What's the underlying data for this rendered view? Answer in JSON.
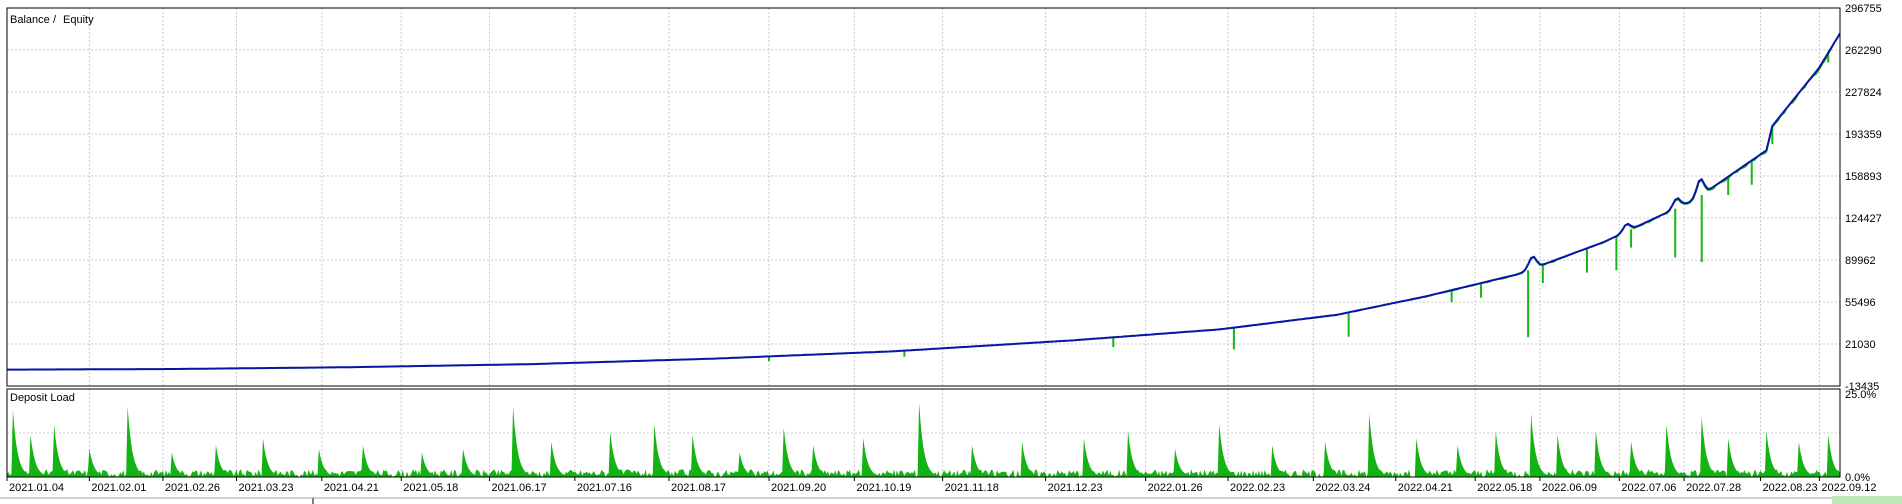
{
  "colors": {
    "balance": "#0a14a6",
    "equity": "#14b814",
    "deposit_load": "#13b313",
    "grid": "#c8c8c8",
    "frame": "#000000",
    "background": "#ffffff"
  },
  "chart_data": [
    {
      "type": "line",
      "panel": "balance-equity",
      "legend": {
        "placement": "top-left",
        "separator": "/"
      },
      "series": [
        {
          "name": "Balance",
          "color": "#0a14a6"
        },
        {
          "name": "Equity",
          "color": "#14b814"
        }
      ],
      "y_ticks": [
        "296755",
        "262290",
        "227824",
        "193359",
        "158893",
        "124427",
        "89962",
        "55496",
        "21030",
        "-13435"
      ],
      "ylim": [
        -13435,
        296755
      ],
      "grid": true,
      "x_start": "2021.01.04",
      "x_end": "2022.09.19",
      "balance_points": [
        [
          "2021.01.04",
          0
        ],
        [
          "2021.03.01",
          500
        ],
        [
          "2021.05.01",
          2000
        ],
        [
          "2021.07.01",
          4500
        ],
        [
          "2021.09.01",
          9000
        ],
        [
          "2021.11.01",
          15000
        ],
        [
          "2022.01.01",
          24000
        ],
        [
          "2022.02.20",
          33000
        ],
        [
          "2022.04.01",
          45000
        ],
        [
          "2022.05.01",
          60000
        ],
        [
          "2022.06.01",
          78000
        ],
        [
          "2022.07.01",
          105000
        ],
        [
          "2022.08.01",
          140000
        ],
        [
          "2022.08.25",
          180000
        ],
        [
          "2022.08.27",
          200000
        ],
        [
          "2022.09.12",
          248000
        ],
        [
          "2022.09.19",
          276000
        ]
      ],
      "balance_bumps": [
        [
          "2022.06.06",
          10000
        ],
        [
          "2022.07.08",
          6000
        ],
        [
          "2022.07.25",
          8000
        ],
        [
          "2022.08.02",
          14000
        ]
      ],
      "equity_drops": [
        [
          "2021.09.20",
          4000
        ],
        [
          "2021.11.05",
          5000
        ],
        [
          "2022.01.15",
          8000
        ],
        [
          "2022.02.25",
          18000
        ],
        [
          "2022.04.05",
          20000
        ],
        [
          "2022.05.10",
          10000
        ],
        [
          "2022.05.20",
          12000
        ],
        [
          "2022.06.05",
          55000
        ],
        [
          "2022.06.10",
          15000
        ],
        [
          "2022.06.25",
          20000
        ],
        [
          "2022.07.05",
          28000
        ],
        [
          "2022.07.10",
          15000
        ],
        [
          "2022.07.25",
          40000
        ],
        [
          "2022.08.03",
          55000
        ],
        [
          "2022.08.12",
          15000
        ],
        [
          "2022.08.20",
          20000
        ],
        [
          "2022.08.27",
          15000
        ],
        [
          "2022.09.15",
          8000
        ]
      ]
    },
    {
      "type": "area",
      "panel": "deposit-load",
      "title": "Deposit Load",
      "y_ticks": [
        "25.0%",
        "0.0%"
      ],
      "ylim": [
        0,
        25
      ],
      "grid": true,
      "peaks": [
        [
          "2021.01.06",
          19
        ],
        [
          "2021.01.12",
          12
        ],
        [
          "2021.01.20",
          15
        ],
        [
          "2021.02.01",
          8
        ],
        [
          "2021.02.14",
          20
        ],
        [
          "2021.03.01",
          7
        ],
        [
          "2021.03.16",
          9
        ],
        [
          "2021.04.01",
          11
        ],
        [
          "2021.04.20",
          8
        ],
        [
          "2021.05.05",
          9
        ],
        [
          "2021.05.25",
          7
        ],
        [
          "2021.06.08",
          8
        ],
        [
          "2021.06.25",
          20
        ],
        [
          "2021.07.08",
          10
        ],
        [
          "2021.07.28",
          13
        ],
        [
          "2021.08.12",
          15
        ],
        [
          "2021.08.25",
          12
        ],
        [
          "2021.09.10",
          7
        ],
        [
          "2021.09.25",
          14
        ],
        [
          "2021.10.05",
          9
        ],
        [
          "2021.10.22",
          11
        ],
        [
          "2021.11.10",
          21
        ],
        [
          "2021.11.28",
          9
        ],
        [
          "2021.12.15",
          10
        ],
        [
          "2022.01.05",
          11
        ],
        [
          "2022.01.20",
          13
        ],
        [
          "2022.02.05",
          8
        ],
        [
          "2022.02.20",
          15
        ],
        [
          "2022.03.10",
          9
        ],
        [
          "2022.03.28",
          10
        ],
        [
          "2022.04.12",
          18
        ],
        [
          "2022.04.28",
          11
        ],
        [
          "2022.05.12",
          9
        ],
        [
          "2022.05.25",
          13
        ],
        [
          "2022.06.06",
          18
        ],
        [
          "2022.06.15",
          12
        ],
        [
          "2022.06.28",
          13
        ],
        [
          "2022.07.10",
          10
        ],
        [
          "2022.07.22",
          15
        ],
        [
          "2022.08.03",
          17
        ],
        [
          "2022.08.12",
          11
        ],
        [
          "2022.08.25",
          13
        ],
        [
          "2022.09.05",
          10
        ],
        [
          "2022.09.15",
          12
        ]
      ]
    }
  ],
  "x_axis": {
    "labels": [
      "2021.01.04",
      "2021.02.01",
      "2021.02.26",
      "2021.03.23",
      "2021.04.21",
      "2021.05.18",
      "2021.06.17",
      "2021.07.16",
      "2021.08.17",
      "2021.09.20",
      "2021.10.19",
      "2021.11.18",
      "2021.12.23",
      "2022.01.26",
      "2022.02.23",
      "2022.03.24",
      "2022.04.21",
      "2022.05.18",
      "2022.06.09",
      "2022.07.06",
      "2022.07.28",
      "2022.08.23",
      "2022.09.12"
    ]
  }
}
